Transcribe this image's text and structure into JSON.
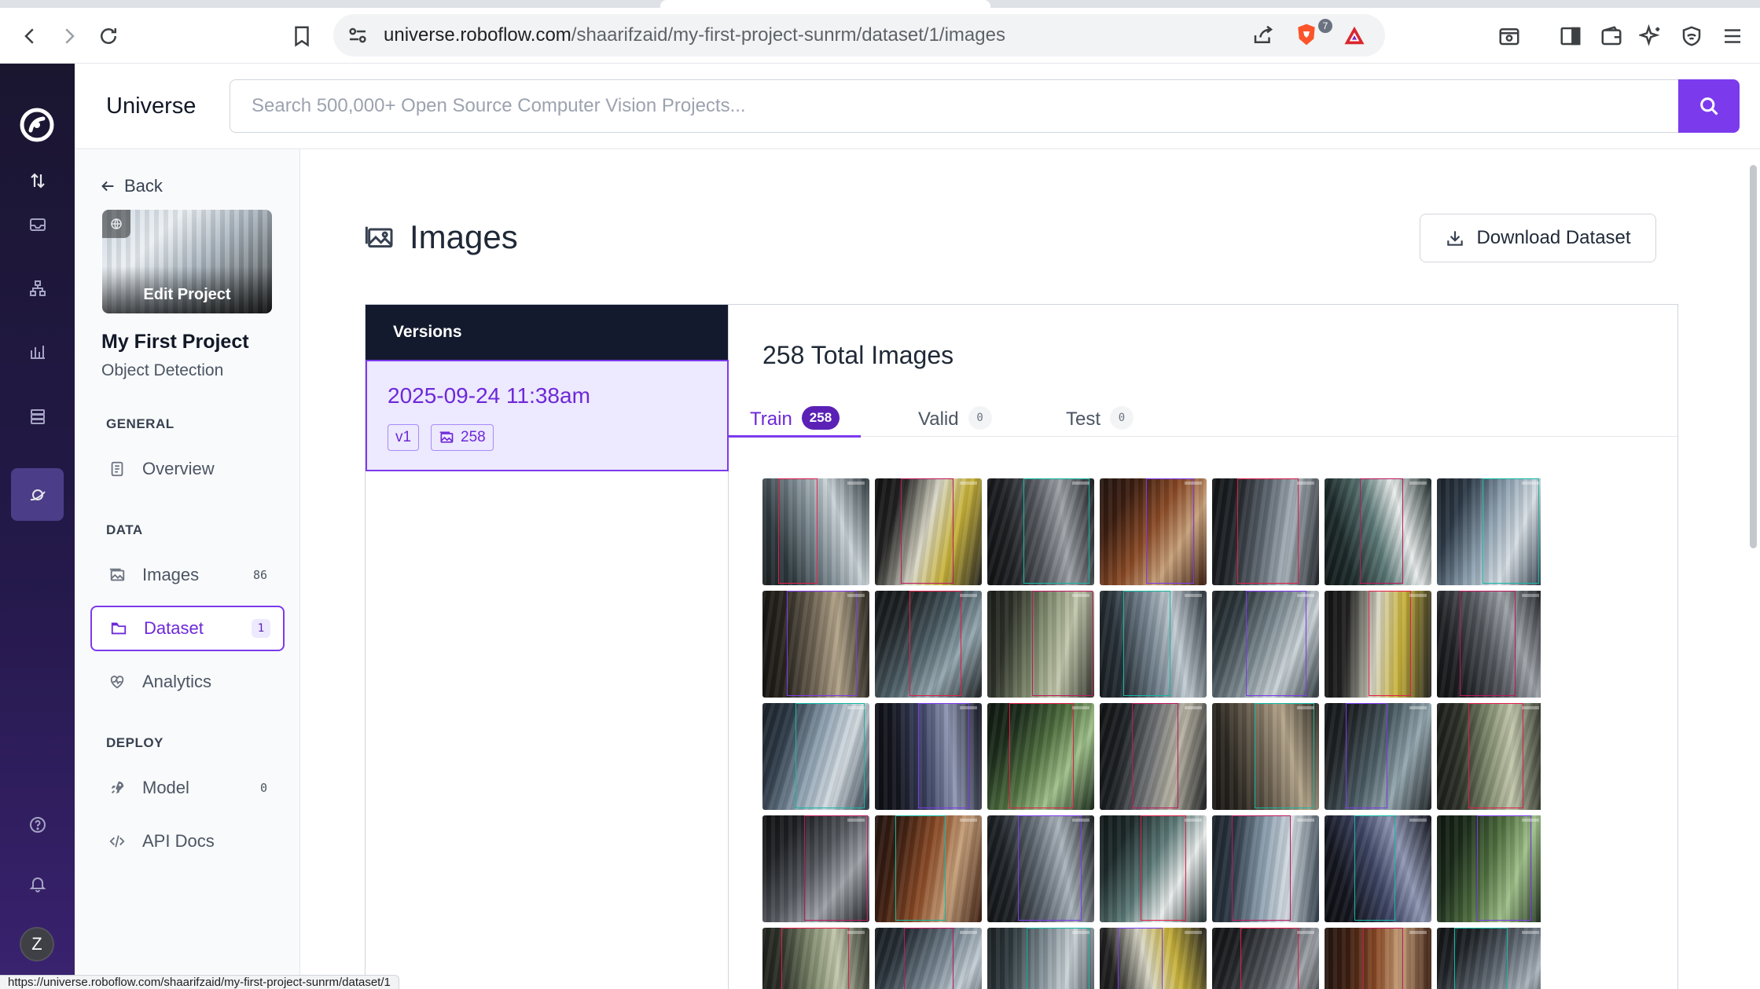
{
  "browser": {
    "url_host": "universe.roboflow.com",
    "url_path": "/shaarifzaid/my-first-project-sunrm/dataset/1/images",
    "shields_count": "7",
    "status_url": "https://universe.roboflow.com/shaarifzaid/my-first-project-sunrm/dataset/1"
  },
  "header": {
    "brand": "Universe",
    "search_placeholder": "Search 500,000+ Open Source Computer Vision Projects..."
  },
  "rail": {
    "avatar_letter": "Z",
    "items": [
      "logo-icon",
      "upload-download-icon",
      "inbox-icon",
      "workflow-icon",
      "chart-icon",
      "database-icon",
      "universe-icon",
      "help-icon",
      "bell-icon"
    ]
  },
  "sidebar": {
    "back_label": "Back",
    "edit_project_label": "Edit Project",
    "project_name": "My First Project",
    "project_type": "Object Detection",
    "sections": {
      "general": "GENERAL",
      "data": "DATA",
      "deploy": "DEPLOY"
    },
    "items": {
      "overview": {
        "label": "Overview"
      },
      "images": {
        "label": "Images",
        "count": "86"
      },
      "dataset": {
        "label": "Dataset",
        "count": "1"
      },
      "analytics": {
        "label": "Analytics"
      },
      "model": {
        "label": "Model",
        "count": "0"
      },
      "api_docs": {
        "label": "API Docs"
      }
    }
  },
  "main": {
    "title": "Images",
    "download_label": "Download Dataset",
    "versions_header": "Versions",
    "version": {
      "name": "2025-09-24 11:38am",
      "tag": "v1",
      "image_count": "258"
    },
    "total_images": "258 Total Images",
    "tabs": [
      {
        "label": "Train",
        "count": "258"
      },
      {
        "label": "Valid",
        "count": "0"
      },
      {
        "label": "Test",
        "count": "0"
      }
    ]
  },
  "colors": {
    "accent": "#7c3aed",
    "accent_dark": "#5b21b6",
    "rail_bg": "#1a1630",
    "versions_header_bg": "#141a2e"
  }
}
